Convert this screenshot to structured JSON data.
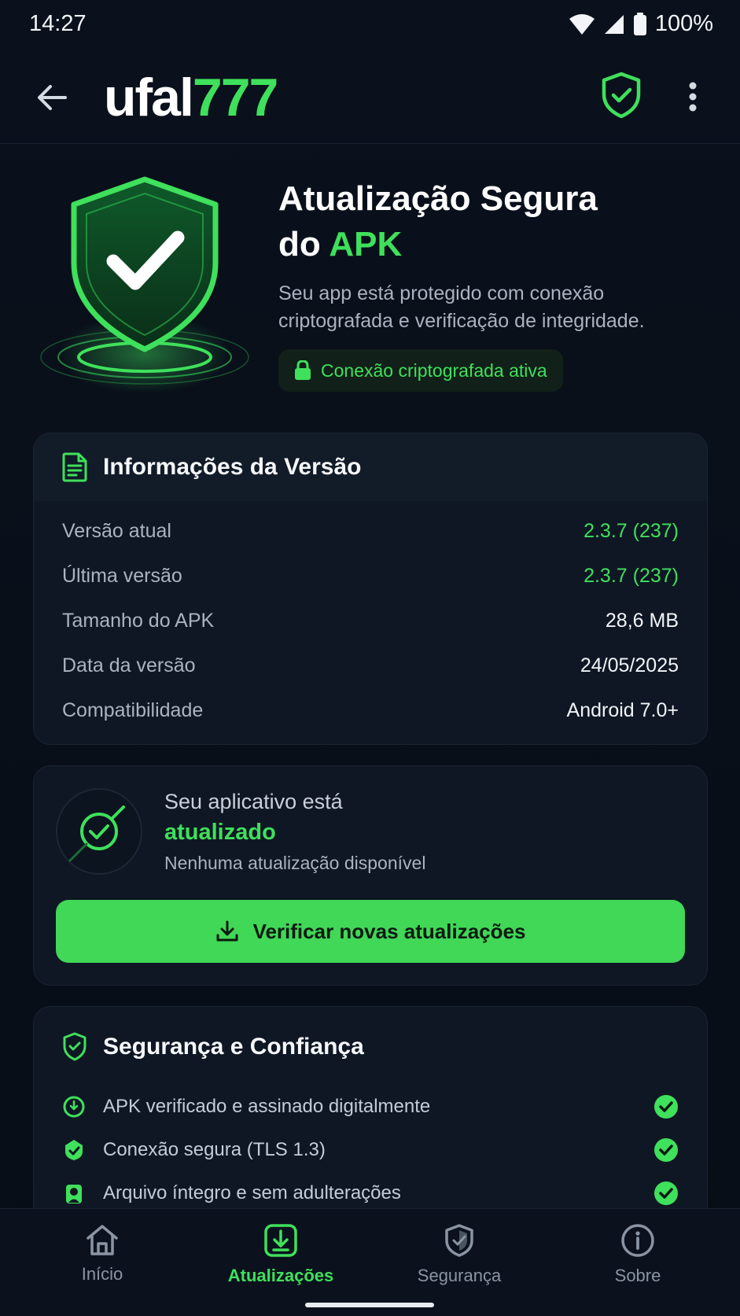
{
  "status_bar": {
    "time": "14:27",
    "battery": "100%"
  },
  "app_bar": {
    "brand_white": "ufal",
    "brand_green": "777"
  },
  "hero": {
    "title_line1": "Atualização Segura",
    "title_prefix": "do ",
    "title_accent": "APK",
    "description": "Seu app está protegido com conexão criptografada e verificação de integridade.",
    "badge": "Conexão criptografada ativa"
  },
  "version_info": {
    "title": "Informações da Versão",
    "rows": [
      {
        "label": "Versão atual",
        "value": "2.3.7 (237)"
      },
      {
        "label": "Última versão",
        "value": "2.3.7 (237)"
      },
      {
        "label": "Tamanho do APK",
        "value": "28,6 MB"
      },
      {
        "label": "Data da versão",
        "value": "24/05/2025"
      },
      {
        "label": "Compatibilidade",
        "value": "Android 7.0+"
      }
    ]
  },
  "update_status": {
    "line1": "Seu aplicativo está",
    "line2": "atualizado",
    "line3": "Nenhuma atualização disponível",
    "button_label": "Verificar novas atualizações"
  },
  "security": {
    "title": "Segurança e Confiança",
    "items": [
      {
        "label": "APK verificado e assinado digitalmente",
        "icon": "badge-check-icon"
      },
      {
        "label": "Conexão segura (TLS 1.3)",
        "icon": "secure-connection-icon"
      },
      {
        "label": "Arquivo íntegro e sem adulterações",
        "icon": "file-integrity-icon"
      }
    ]
  },
  "bottom_nav": {
    "items": [
      {
        "label": "Início",
        "icon": "home-icon"
      },
      {
        "label": "Atualizações",
        "icon": "download-icon"
      },
      {
        "label": "Segurança",
        "icon": "shield-icon"
      },
      {
        "label": "Sobre",
        "icon": "info-icon"
      }
    ],
    "active_index": 1
  },
  "colors": {
    "accent": "#3fe05b",
    "background": "#070d17",
    "card": "#0f1724"
  }
}
